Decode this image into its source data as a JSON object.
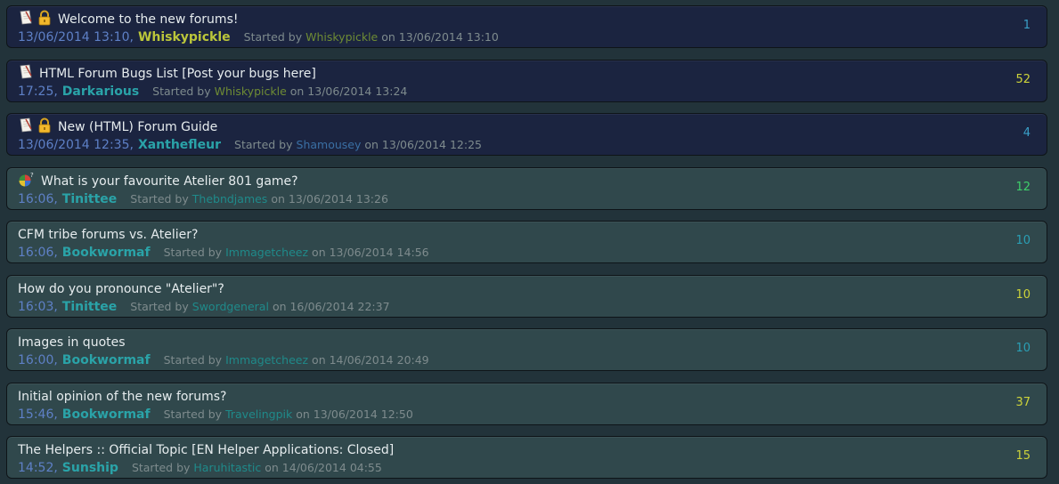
{
  "colors": {
    "pinned_bg": "#1b2440",
    "normal_bg": "#30484c",
    "time": "#5e80c6",
    "started_label": "#7e8b8d",
    "user_yellow": "#bbc63a",
    "user_teal": "#2aa3a8",
    "user_olive": "#6e8b34",
    "user_blue": "#3a6fa4",
    "user_teal_dark": "#1f8a8a",
    "count_blue": "#3aa0c8",
    "count_yellow": "#cdd33a",
    "count_green": "#3ecf6a",
    "count_teal": "#2a9fb5"
  },
  "topics": [
    {
      "title": "Welcome to the new forums!",
      "icons": [
        "note-icon",
        "lock-icon"
      ],
      "time": "13/06/2014 13:10,",
      "last_poster": "Whiskypickle",
      "last_color": "#bbc63a",
      "started_label": "Started by",
      "starter": "Whiskypickle",
      "starter_color": "#6e8b34",
      "start_date": "on 13/06/2014 13:10",
      "count": "1",
      "count_color": "#3aa0c8",
      "pinned": true
    },
    {
      "title": "HTML Forum Bugs List [Post your bugs here]",
      "icons": [
        "note-icon"
      ],
      "time": "17:25,",
      "last_poster": "Darkarious",
      "last_color": "#2aa3a8",
      "started_label": "Started by",
      "starter": "Whiskypickle",
      "starter_color": "#6e8b34",
      "start_date": "on 13/06/2014 13:24",
      "count": "52",
      "count_color": "#cdd33a",
      "pinned": true
    },
    {
      "title": "New (HTML) Forum Guide",
      "icons": [
        "note-icon",
        "lock-icon"
      ],
      "time": "13/06/2014 12:35,",
      "last_poster": "Xanthefleur",
      "last_color": "#2aa3a8",
      "started_label": "Started by",
      "starter": "Shamousey",
      "starter_color": "#3a6fa4",
      "start_date": "on 13/06/2014 12:25",
      "count": "4",
      "count_color": "#3aa0c8",
      "pinned": true
    },
    {
      "title": "What is your favourite Atelier 801 game?",
      "icons": [
        "poll-icon"
      ],
      "time": "16:06,",
      "last_poster": "Tinittee",
      "last_color": "#2aa3a8",
      "started_label": "Started by",
      "starter": "Thebndjames",
      "starter_color": "#1f8a8a",
      "start_date": "on 13/06/2014 13:26",
      "count": "12",
      "count_color": "#3ecf6a",
      "pinned": false
    },
    {
      "title": "CFM tribe forums vs. Atelier?",
      "icons": [],
      "time": "16:06,",
      "last_poster": "Bookwormaf",
      "last_color": "#2aa3a8",
      "started_label": "Started by",
      "starter": "Immagetcheez",
      "starter_color": "#1f8a8a",
      "start_date": "on 13/06/2014 14:56",
      "count": "10",
      "count_color": "#2a9fb5",
      "pinned": false
    },
    {
      "title": "How do you pronounce \"Atelier\"?",
      "icons": [],
      "time": "16:03,",
      "last_poster": "Tinittee",
      "last_color": "#2aa3a8",
      "started_label": "Started by",
      "starter": "Swordgeneral",
      "starter_color": "#1f8a8a",
      "start_date": "on 16/06/2014 22:37",
      "count": "10",
      "count_color": "#cdd33a",
      "pinned": false
    },
    {
      "title": "Images in quotes",
      "icons": [],
      "time": "16:00,",
      "last_poster": "Bookwormaf",
      "last_color": "#2aa3a8",
      "started_label": "Started by",
      "starter": "Immagetcheez",
      "starter_color": "#1f8a8a",
      "start_date": "on 14/06/2014 20:49",
      "count": "10",
      "count_color": "#2a9fb5",
      "pinned": false
    },
    {
      "title": "Initial opinion of the new forums?",
      "icons": [],
      "time": "15:46,",
      "last_poster": "Bookwormaf",
      "last_color": "#2aa3a8",
      "started_label": "Started by",
      "starter": "Travelingpik",
      "starter_color": "#1f8a8a",
      "start_date": "on 13/06/2014 12:50",
      "count": "37",
      "count_color": "#cdd33a",
      "pinned": false
    },
    {
      "title": "The Helpers :: Official Topic [EN Helper Applications: Closed]",
      "icons": [],
      "time": "14:52,",
      "last_poster": "Sunship",
      "last_color": "#2aa3a8",
      "started_label": "Started by",
      "starter": "Haruhitastic",
      "starter_color": "#1f8a8a",
      "start_date": "on 14/06/2014 04:55",
      "count": "15",
      "count_color": "#cdd33a",
      "pinned": false
    }
  ]
}
